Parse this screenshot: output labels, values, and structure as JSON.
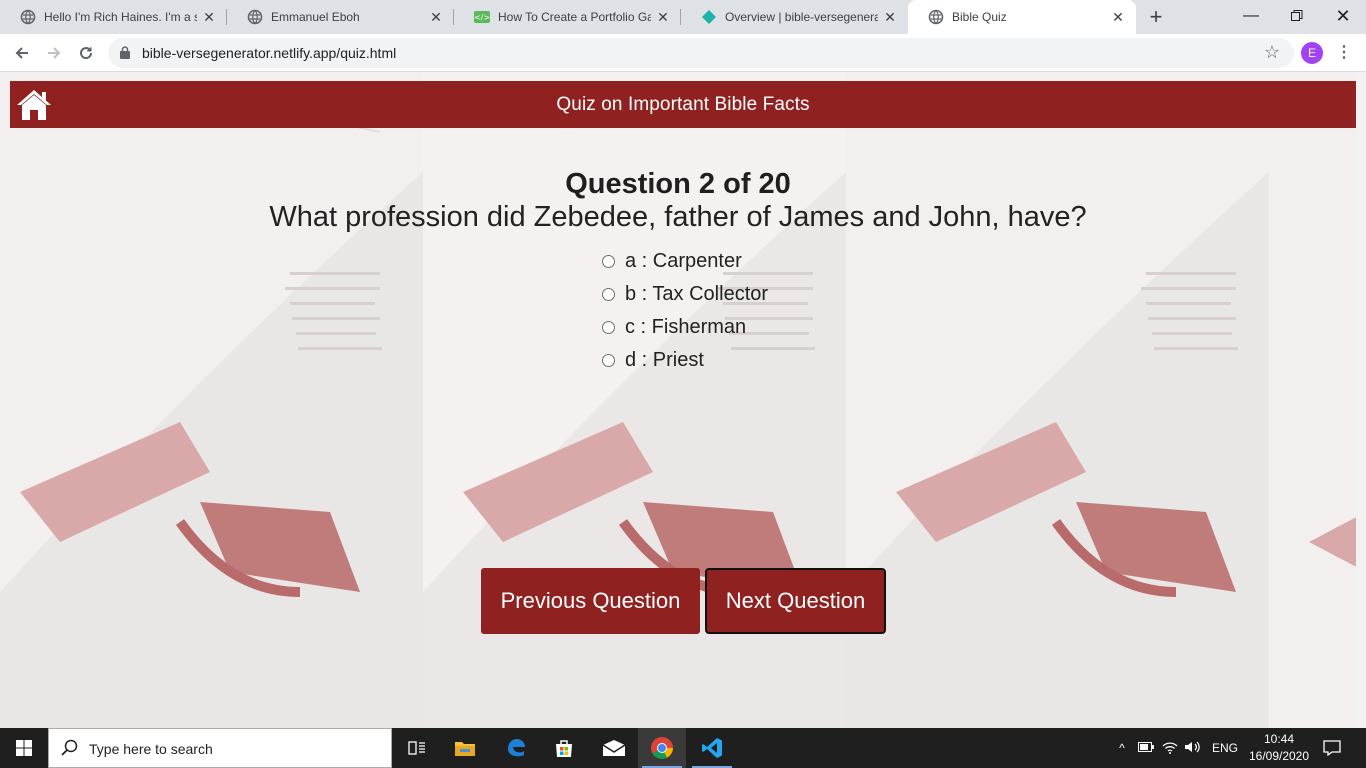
{
  "browser": {
    "tabs": [
      {
        "title": "Hello I'm Rich Haines. I'm a sof",
        "icon": "globe-icon"
      },
      {
        "title": "Emmanuel Eboh",
        "icon": "globe-icon"
      },
      {
        "title": "How To Create a Portfolio Gall",
        "icon": "codepen-icon"
      },
      {
        "title": "Overview | bible-versegenerato",
        "icon": "netlify-icon"
      },
      {
        "title": "Bible Quiz",
        "icon": "globe-icon",
        "active": true
      }
    ],
    "url": "bible-versegenerator.netlify.app/quiz.html",
    "profile_initial": "E"
  },
  "page": {
    "header_title": "Quiz on Important Bible Facts",
    "question_number": "Question 2 of 20",
    "question_text": "What profession did Zebedee, father of James and John, have?",
    "options": [
      {
        "label": "a : Carpenter"
      },
      {
        "label": "b : Tax Collector"
      },
      {
        "label": "c : Fisherman"
      },
      {
        "label": "d : Priest"
      }
    ],
    "prev_button": "Previous Question",
    "next_button": "Next Question",
    "colors": {
      "header": "#8f2121",
      "button": "#8f2121"
    }
  },
  "taskbar": {
    "search_placeholder": "Type here to search",
    "language": "ENG",
    "time": "10:44",
    "date": "16/09/2020"
  }
}
